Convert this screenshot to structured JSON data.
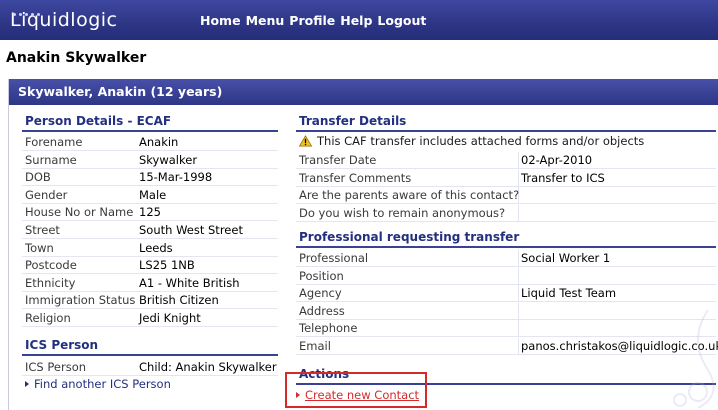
{
  "app": {
    "logo": "Liquidlogic",
    "nav": [
      "Home",
      "Menu",
      "Profile",
      "Help",
      "Logout"
    ]
  },
  "person_title": "Anakin Skywalker",
  "panel_title": "Skywalker, Anakin (12 years)",
  "person_details": {
    "heading": "Person Details - ECAF",
    "rows": [
      {
        "label": "Forename",
        "value": "Anakin"
      },
      {
        "label": "Surname",
        "value": "Skywalker"
      },
      {
        "label": "DOB",
        "value": "15-Mar-1998"
      },
      {
        "label": "Gender",
        "value": "Male"
      },
      {
        "label": "House No or Name",
        "value": "125"
      },
      {
        "label": "Street",
        "value": "South West Street"
      },
      {
        "label": "Town",
        "value": "Leeds"
      },
      {
        "label": "Postcode",
        "value": "LS25 1NB"
      },
      {
        "label": "Ethnicity",
        "value": "A1 - White British"
      },
      {
        "label": "Immigration Status",
        "value": "British Citizen"
      },
      {
        "label": "Religion",
        "value": "Jedi Knight"
      }
    ]
  },
  "ics_person": {
    "heading": "ICS Person",
    "label": "ICS Person",
    "value": "Child: Anakin Skywalker",
    "find_link": "Find another ICS Person"
  },
  "transfer_details": {
    "heading": "Transfer Details",
    "notice": "This CAF transfer includes attached forms and/or objects",
    "rows": [
      {
        "label": "Transfer Date",
        "value": "02-Apr-2010"
      },
      {
        "label": "Transfer Comments",
        "value": "Transfer to ICS"
      },
      {
        "label": "Are the parents aware of this contact?",
        "value": ""
      },
      {
        "label": "Do you wish to remain anonymous?",
        "value": ""
      }
    ]
  },
  "professional": {
    "heading": "Professional requesting transfer",
    "rows": [
      {
        "label": "Professional",
        "value": "Social Worker 1"
      },
      {
        "label": "Position",
        "value": ""
      },
      {
        "label": "Agency",
        "value": "Liquid Test Team"
      },
      {
        "label": "Address",
        "value": ""
      },
      {
        "label": "Telephone",
        "value": ""
      },
      {
        "label": "Email",
        "value": "panos.christakos@liquidlogic.co.uk"
      }
    ]
  },
  "actions": {
    "heading": "Actions",
    "create_link": "Create new Contact"
  },
  "icons": [
    "warning-icon",
    "bullet-arrow-icon"
  ],
  "colors": {
    "brand": "#2d3585",
    "highlight": "#d42a2a"
  }
}
